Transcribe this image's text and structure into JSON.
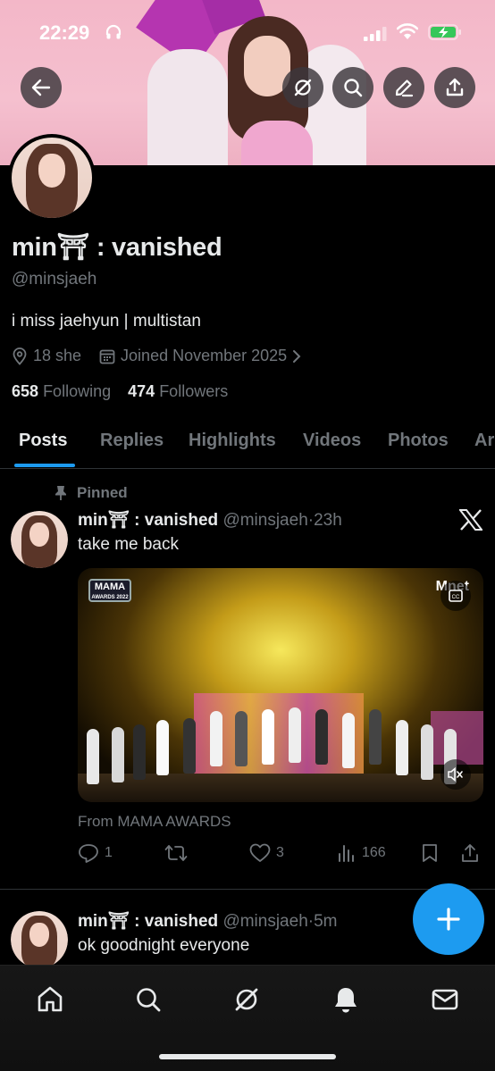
{
  "status_bar": {
    "time": "22:29"
  },
  "profile": {
    "name": "min⛩ : vanished",
    "handle": "@minsjaeh",
    "bio": "i miss jaehyun | multistan",
    "location": "18 she",
    "joined": "Joined November 2025",
    "following_count": "658",
    "following_label": "Following",
    "followers_count": "474",
    "followers_label": "Followers"
  },
  "tabs": [
    {
      "label": "Posts"
    },
    {
      "label": "Replies"
    },
    {
      "label": "Highlights"
    },
    {
      "label": "Videos"
    },
    {
      "label": "Photos"
    },
    {
      "label": "Ar"
    }
  ],
  "posts": [
    {
      "pinned_label": "Pinned",
      "name": "min⛩ : vanished",
      "handle": "@minsjaeh",
      "time": "23h",
      "text": "take me back",
      "media_source": "From MAMA AWARDS",
      "media_logo_top": "MAMA",
      "media_logo_bottom": "AWARDS 2022",
      "media_brand": "Mnet",
      "replies": "1",
      "likes": "3",
      "views": "166"
    },
    {
      "name": "min⛩ : vanished",
      "handle": "@minsjaeh",
      "time": "5m",
      "text": "ok goodnight everyone"
    }
  ],
  "colors": {
    "accent": "#1d9bf0",
    "muted": "#71767b",
    "text": "#e7e9ea",
    "bg": "#000000"
  },
  "icons": [
    "back-arrow-icon",
    "grok-icon",
    "search-icon",
    "edit-icon",
    "share-icon",
    "location-icon",
    "calendar-icon",
    "chevron-right-icon",
    "pin-icon",
    "x-logo-icon",
    "reply-icon",
    "repost-icon",
    "like-icon",
    "views-icon",
    "bookmark-icon",
    "home-icon",
    "bell-icon",
    "mail-icon",
    "plus-icon"
  ]
}
